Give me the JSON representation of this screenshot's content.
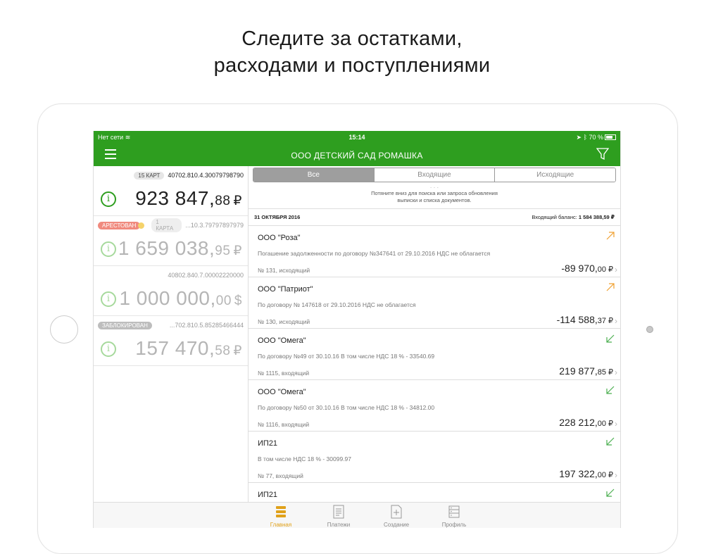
{
  "headline": {
    "line1": "Следите за остатками,",
    "line2": "расходами и поступлениями"
  },
  "status_bar": {
    "network": "Нет сети",
    "time": "15:14",
    "battery": "70 %"
  },
  "nav": {
    "title": "ООО ДЕТСКИЙ САД РОМАШКА",
    "menu_icon": "hamburger-icon",
    "filter_icon": "filter-icon"
  },
  "accounts": [
    {
      "badge": "15 КАРТ",
      "number": "40702.810.4.30079798790",
      "whole": "923 847,",
      "cents": "88",
      "currency": "₽"
    },
    {
      "status": "АРЕСТОВАН",
      "badge": "1 КАРТА",
      "number": "...10.3.79797897979",
      "whole": "1 659 038,",
      "cents": "95",
      "currency": "₽"
    },
    {
      "number": "40802.840.7.00002220000",
      "whole": "1 000 000,",
      "cents": "00",
      "currency": "$"
    },
    {
      "status": "ЗАБЛОКИРОВАН",
      "number": "...702.810.5.85285466444",
      "whole": "157 470,",
      "cents": "58",
      "currency": "₽"
    }
  ],
  "segments": {
    "all": "Все",
    "incoming": "Входящие",
    "outgoing": "Исходящие"
  },
  "pull_hint": {
    "line1": "Потяните вниз для поиска или запроса обновления",
    "line2": "выписки и списка документов."
  },
  "date_header": {
    "date": "31 ОКТЯБРЯ 2016",
    "balance_label": "Входящий баланс:",
    "balance_value": "1 584 388,59 ₽"
  },
  "transactions": [
    {
      "name": "ООО \"Роза\"",
      "desc": "Погашение задолженности по договору №347641 от 29.10.2016 НДС не облагается",
      "meta": "№ 131, исходящий",
      "whole": "-89 970,",
      "cents": "00",
      "currency": "₽",
      "direction": "out"
    },
    {
      "name": "ООО \"Патриот\"",
      "desc": "По договору № 147618 от 29.10.2016 НДС не облагается",
      "meta": "№ 130, исходящий",
      "whole": "-114 588,",
      "cents": "37",
      "currency": "₽",
      "direction": "out"
    },
    {
      "name": "ООО \"Омега\"",
      "desc": "По договору №49 от 30.10.16 В том числе НДС 18 % - 33540.69",
      "meta": "№ 1115, входящий",
      "whole": "219 877,",
      "cents": "85",
      "currency": "₽",
      "direction": "in"
    },
    {
      "name": "ООО \"Омега\"",
      "desc": "По договору №50 от 30.10.16 В том числе НДС 18 % - 34812.00",
      "meta": "№ 1116, входящий",
      "whole": "228 212,",
      "cents": "00",
      "currency": "₽",
      "direction": "in"
    },
    {
      "name": "ИП21",
      "desc": "В том числе НДС 18 % - 30099.97",
      "meta": "№ 77, входящий",
      "whole": "197 322,",
      "cents": "00",
      "currency": "₽",
      "direction": "in"
    },
    {
      "name": "ИП21",
      "desc": "",
      "meta": "",
      "whole": "",
      "cents": "",
      "currency": "",
      "direction": "in"
    }
  ],
  "tabs": {
    "home": "Главная",
    "payments": "Платежи",
    "create": "Создание",
    "profile": "Профиль"
  },
  "colors": {
    "brand_green": "#2e9e1f",
    "outgoing_arrow": "#f0a030",
    "incoming_arrow": "#4caf50",
    "active_tab": "#e0a11a"
  }
}
